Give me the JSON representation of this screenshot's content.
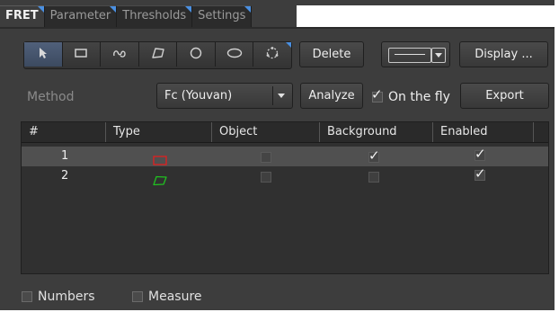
{
  "tabs": [
    {
      "label": "FRET",
      "active": true
    },
    {
      "label": "Parameter",
      "active": false
    },
    {
      "label": "Thresholds",
      "active": false
    },
    {
      "label": "Settings",
      "active": false
    }
  ],
  "toolbar": {
    "tools": [
      "pointer-icon",
      "rectangle-icon",
      "freehand-icon",
      "polygon-icon",
      "circle-icon",
      "ellipse-icon",
      "circle-points-icon"
    ],
    "delete_label": "Delete",
    "display_label": "Display ..."
  },
  "method": {
    "label": "Method",
    "selected": "Fc (Youvan)",
    "analyze_label": "Analyze",
    "on_the_fly_label": "On the fly",
    "on_the_fly_checked": true,
    "export_label": "Export"
  },
  "table": {
    "columns": [
      "#",
      "Type",
      "Object",
      "Background",
      "Enabled"
    ],
    "rows": [
      {
        "num": "1",
        "type": "rectangle",
        "type_color": "#e02020",
        "object": false,
        "background": true,
        "enabled": true
      },
      {
        "num": "2",
        "type": "polygon",
        "type_color": "#20c020",
        "object": false,
        "background": false,
        "enabled": true
      }
    ]
  },
  "footer": {
    "numbers_label": "Numbers",
    "measure_label": "Measure"
  },
  "colors": {
    "accent": "#4a90e2",
    "panel": "#3d3d3d"
  }
}
